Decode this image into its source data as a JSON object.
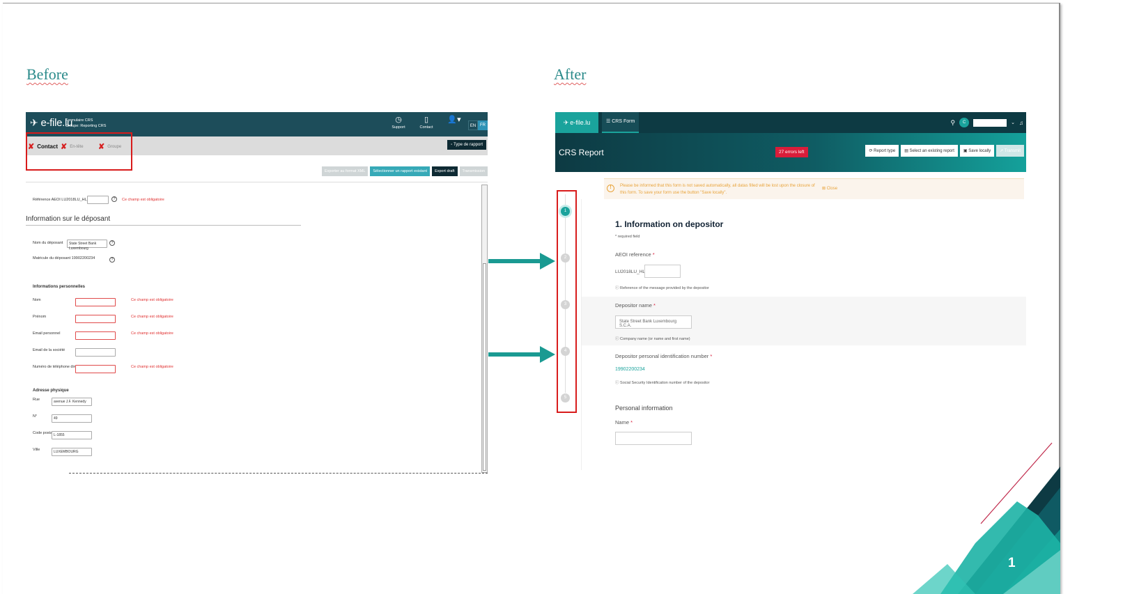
{
  "slide": {
    "before_heading": "Before",
    "after_heading": "After",
    "page_number": "1"
  },
  "before": {
    "logo": "e-file.lu",
    "form_title": "Formulaire CRS",
    "form_group": "Groupe: Reporting CRS",
    "top_icons": [
      {
        "name": "support-icon",
        "label": "Support"
      },
      {
        "name": "contact-icon",
        "label": "Contact"
      }
    ],
    "languages": [
      "EN",
      "FR"
    ],
    "tabs": [
      "Contact",
      "En-tête",
      "Groupe"
    ],
    "type_button": "Type de rapport",
    "actions": [
      "Exporter au format XML",
      "Sélectionner un rapport existant",
      "Export draft",
      "Transmission"
    ],
    "aeoi_label": "Référence AEOI",
    "aeoi_prefix": "LU2018LU_HL_0_",
    "error_text": "Ce champ est obligatoire",
    "section_title": "Information sur le déposant",
    "depositor_name_label": "Nom du déposant",
    "depositor_name_value": "State Street Bank Luxembourg",
    "matricule_label": "Matricule du déposant",
    "matricule_value": "19902200234",
    "personal_title": "Informations personnelles",
    "personal_fields": [
      "Nom",
      "Prénom",
      "Email personnel",
      "Email de la société",
      "Numéro de téléphone direct"
    ],
    "address_title": "Adresse physique",
    "address_fields": [
      {
        "label": "Rue",
        "value": "avenue J.F. Kennedy"
      },
      {
        "label": "N°",
        "value": "49"
      },
      {
        "label": "Code postal",
        "value": "L-1855"
      },
      {
        "label": "Ville",
        "value": "LUXEMBOURG"
      }
    ]
  },
  "after": {
    "logo": "e-file.lu",
    "tab": "CRS Form",
    "avatar": "C",
    "title": "CRS Report",
    "errors_badge": "27 errors left",
    "buttons": [
      "Report type",
      "Select an existing report",
      "Save locally",
      "Transmit"
    ],
    "alert_text": "Please be informed that this form is not saved automatically, all datas filled will be lost upon the closure of this form. To save your form use the button \"Save locally\".",
    "alert_close": "Close",
    "steps": [
      "1",
      "2",
      "3",
      "4",
      "5"
    ],
    "section_title": "1. Information on depositor",
    "required_note": "* required field",
    "aeoi_label": "AEOI reference",
    "aeoi_prefix": "LU2018LU_HL_",
    "aeoi_help": "Reference of the message provided by the depositor",
    "depositor_name_label": "Depositor name",
    "depositor_name_value": "State Street Bank Luxembourg S.C.A.",
    "depositor_name_help": "Company name (or name and first name)",
    "pin_label": "Depositor personal identification number",
    "pin_value": "19902200234",
    "pin_help": "Social Security Identification number of the depositor",
    "personal_title": "Personal information",
    "name_label": "Name",
    "required_mark": "*"
  },
  "colors": {
    "teal_accent": "#1aa39c",
    "dark_header": "#0d3a43",
    "error_red": "#d91d3a",
    "highlight_red": "#d81b1b"
  }
}
